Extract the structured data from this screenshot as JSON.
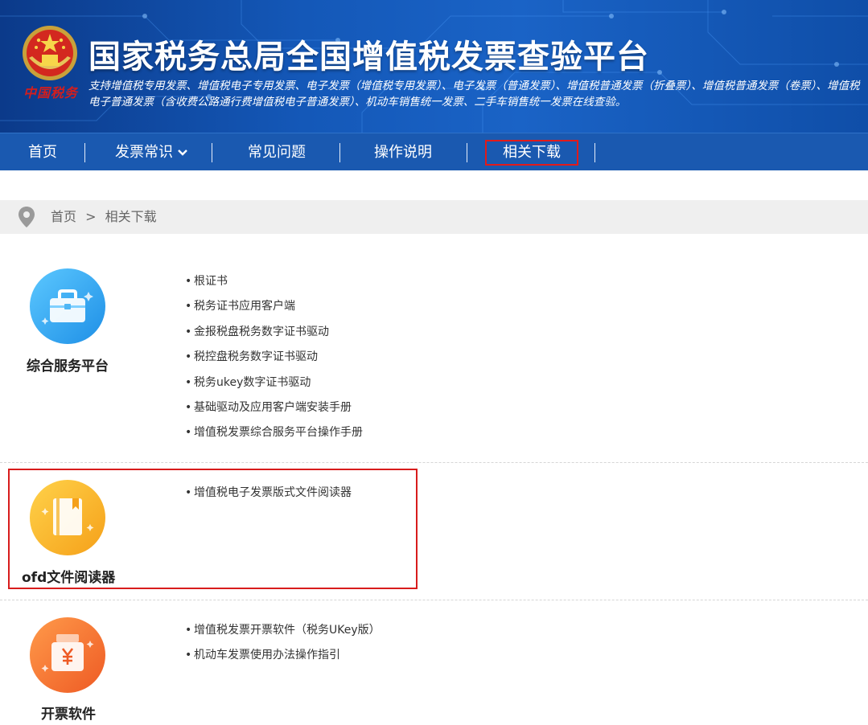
{
  "header": {
    "title": "国家税务总局全国增值税发票查验平台",
    "subtitle": "支持增值税专用发票、增值税电子专用发票、电子发票（增值税专用发票）、电子发票（普通发票）、增值税普通发票（折叠票）、增值税普通发票（卷票）、增值税电子普通发票（含收费公路通行费增值税电子普通发票）、机动车销售统一发票、二手车销售统一发票在线查验。",
    "emblem_caption": "中国税务",
    "colors": {
      "banner": "#1458b8",
      "nav": "#1a59b0",
      "highlight": "#d81c1c"
    }
  },
  "nav": {
    "items": [
      {
        "label": "首页"
      },
      {
        "label": "发票常识",
        "has_dropdown": true,
        "icon": "chevron-down-icon"
      },
      {
        "label": "常见问题"
      },
      {
        "label": "操作说明"
      },
      {
        "label": "相关下载",
        "active": true
      }
    ]
  },
  "breadcrumb": {
    "icon": "location-pin-icon",
    "home": "首页",
    "separator": ">",
    "current": "相关下载"
  },
  "sections": [
    {
      "label": "综合服务平台",
      "icon": "briefcase-icon",
      "color": "#2ea6f0",
      "items": [
        "根证书",
        "税务证书应用客户端",
        "金报税盘税务数字证书驱动",
        "税控盘税务数字证书驱动",
        "税务ukey数字证书驱动",
        "基础驱动及应用客户端安装手册",
        "增值税发票综合服务平台操作手册"
      ]
    },
    {
      "label": "ofd文件阅读器",
      "icon": "book-icon",
      "color": "#f7b52c",
      "items": [
        "增值税电子发票版式文件阅读器"
      ]
    },
    {
      "label": "开票软件",
      "icon": "yuan-box-icon",
      "color": "#f26b2a",
      "items": [
        "增值税发票开票软件（税务UKey版）",
        "机动车发票使用办法操作指引"
      ]
    }
  ]
}
